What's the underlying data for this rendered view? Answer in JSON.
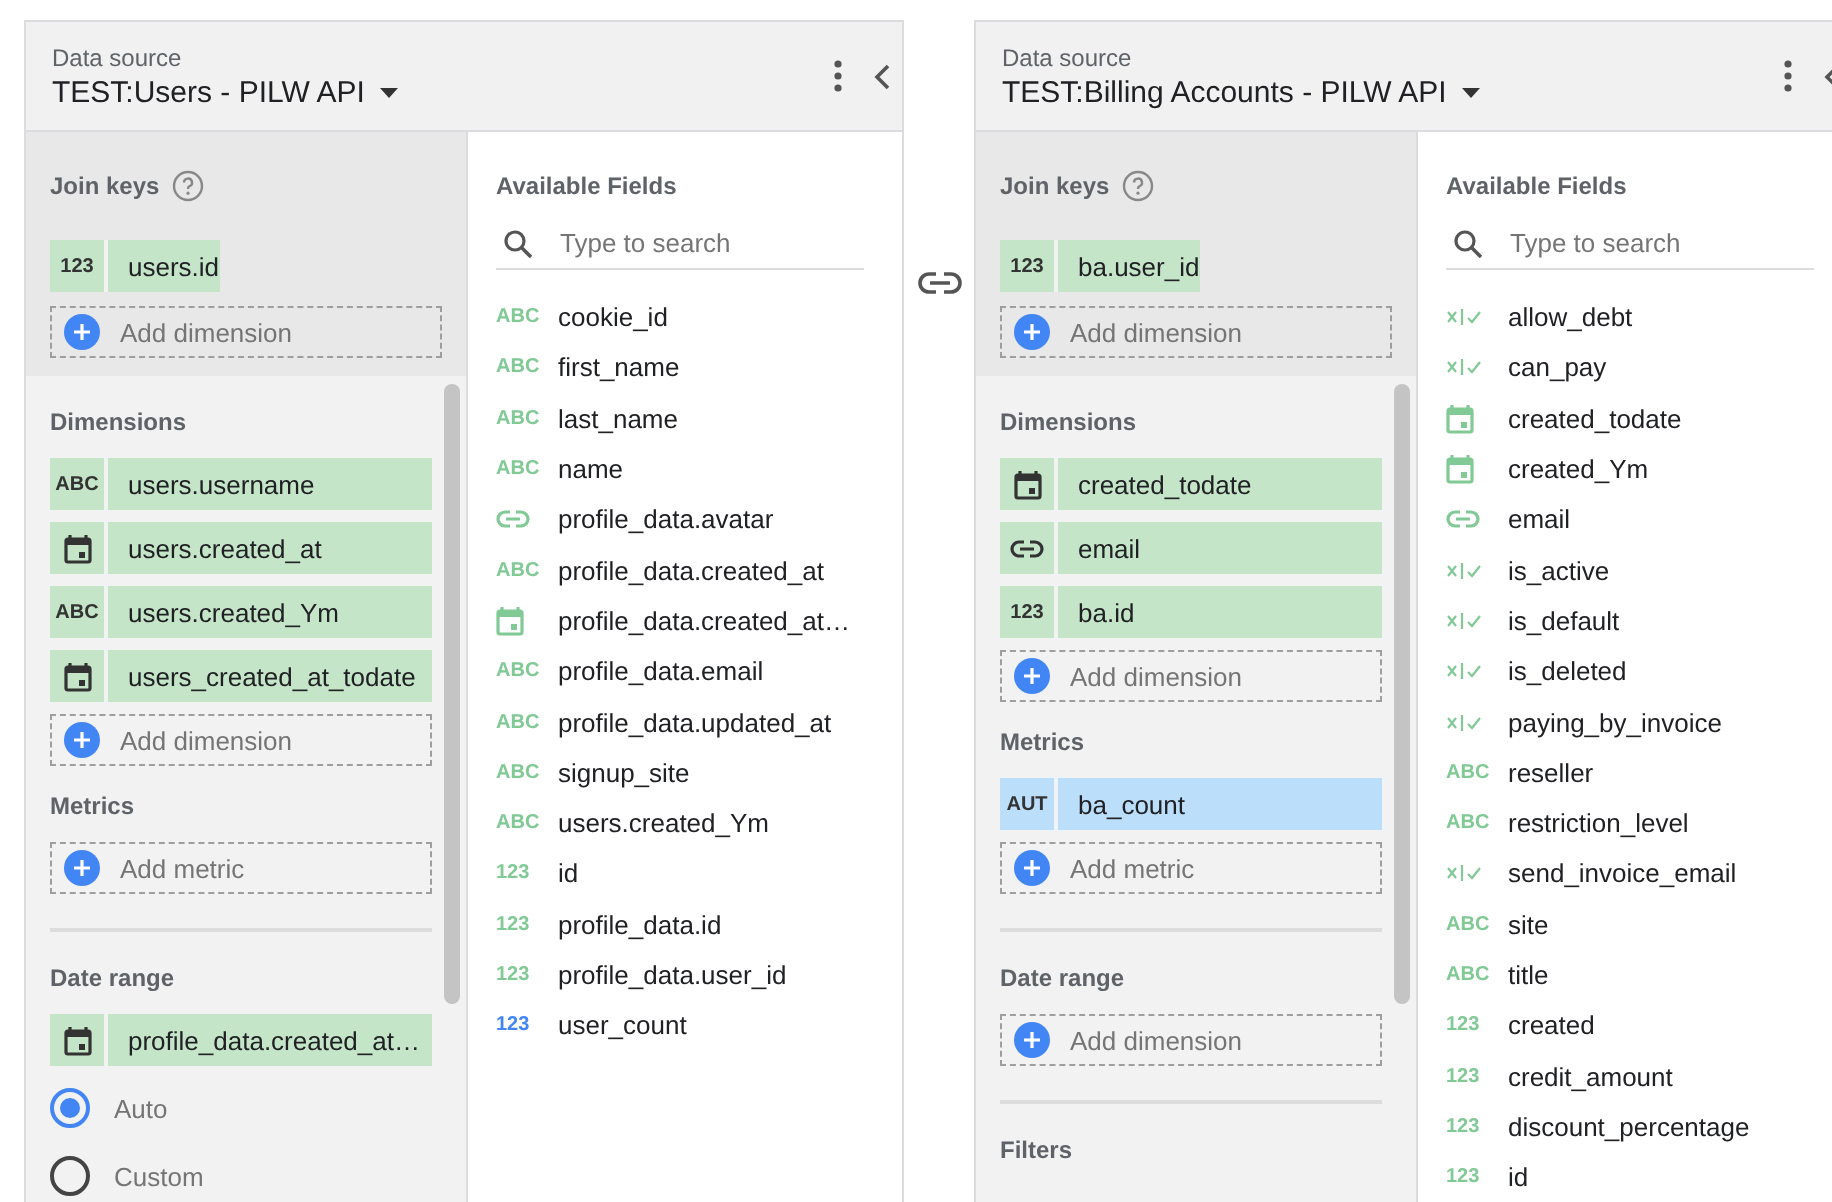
{
  "panels": [
    {
      "label": "Data source",
      "title": "TEST:Users - PILW API",
      "join_keys": {
        "heading": "Join keys",
        "fields": [
          {
            "kind": "number",
            "type_label": "123",
            "name": "users.id"
          }
        ],
        "add_label": "Add dimension"
      },
      "groups": [
        {
          "sections": [
            {
              "heading": "Dimensions",
              "fields": [
                {
                  "kind": "text",
                  "type_label": "ABC",
                  "name": "users.username"
                },
                {
                  "kind": "date",
                  "name": "users.created_at"
                },
                {
                  "kind": "text",
                  "type_label": "ABC",
                  "name": "users.created_Ym"
                },
                {
                  "kind": "date",
                  "name": "users_created_at_todate"
                }
              ],
              "add_label": "Add dimension"
            },
            {
              "heading": "Metrics",
              "add_label": "Add metric"
            }
          ]
        },
        {
          "sections": [
            {
              "heading": "Date range",
              "fields": [
                {
                  "kind": "date",
                  "name": "profile_data.created_at…"
                }
              ],
              "options": [
                {
                  "label": "Auto",
                  "selected": true
                },
                {
                  "label": "Custom",
                  "selected": false
                }
              ]
            }
          ]
        }
      ],
      "available": {
        "heading": "Available Fields",
        "search": {
          "placeholder": "Type to search"
        },
        "fields": [
          {
            "kind": "text",
            "type_label": "ABC",
            "name": "cookie_id"
          },
          {
            "kind": "text",
            "type_label": "ABC",
            "name": "first_name"
          },
          {
            "kind": "text",
            "type_label": "ABC",
            "name": "last_name"
          },
          {
            "kind": "text",
            "type_label": "ABC",
            "name": "name"
          },
          {
            "kind": "link",
            "name": "profile_data.avatar"
          },
          {
            "kind": "text",
            "type_label": "ABC",
            "name": "profile_data.created_at"
          },
          {
            "kind": "date",
            "name": "profile_data.created_at…"
          },
          {
            "kind": "text",
            "type_label": "ABC",
            "name": "profile_data.email"
          },
          {
            "kind": "text",
            "type_label": "ABC",
            "name": "profile_data.updated_at"
          },
          {
            "kind": "text",
            "type_label": "ABC",
            "name": "signup_site"
          },
          {
            "kind": "text",
            "type_label": "ABC",
            "name": "users.created_Ym"
          },
          {
            "kind": "number",
            "type_label": "123",
            "name": "id"
          },
          {
            "kind": "number",
            "type_label": "123",
            "name": "profile_data.id"
          },
          {
            "kind": "number",
            "type_label": "123",
            "name": "profile_data.user_id"
          },
          {
            "kind": "measure",
            "type_label": "123",
            "name": "user_count"
          }
        ]
      }
    },
    {
      "label": "Data source",
      "title": "TEST:Billing Accounts - PILW API",
      "join_keys": {
        "heading": "Join keys",
        "fields": [
          {
            "kind": "number",
            "type_label": "123",
            "name": "ba.user_id"
          }
        ],
        "add_label": "Add dimension"
      },
      "groups": [
        {
          "sections": [
            {
              "heading": "Dimensions",
              "fields": [
                {
                  "kind": "date",
                  "name": "created_todate"
                },
                {
                  "kind": "link",
                  "name": "email"
                },
                {
                  "kind": "number",
                  "type_label": "123",
                  "name": "ba.id"
                }
              ],
              "add_label": "Add dimension"
            },
            {
              "heading": "Metrics",
              "fields": [
                {
                  "kind": "auto",
                  "type_label": "AUT",
                  "name": "ba_count"
                }
              ],
              "add_label": "Add metric"
            }
          ]
        },
        {
          "sections": [
            {
              "heading": "Date range",
              "add_label": "Add dimension"
            }
          ]
        },
        {
          "sections": [
            {
              "heading": "Filters"
            }
          ]
        }
      ],
      "available": {
        "heading": "Available Fields",
        "search": {
          "placeholder": "Type to search"
        },
        "fields": [
          {
            "kind": "boolean",
            "name": "allow_debt"
          },
          {
            "kind": "boolean",
            "name": "can_pay"
          },
          {
            "kind": "date",
            "name": "created_todate"
          },
          {
            "kind": "date",
            "name": "created_Ym"
          },
          {
            "kind": "link",
            "name": "email"
          },
          {
            "kind": "boolean",
            "name": "is_active"
          },
          {
            "kind": "boolean",
            "name": "is_default"
          },
          {
            "kind": "boolean",
            "name": "is_deleted"
          },
          {
            "kind": "boolean",
            "name": "paying_by_invoice"
          },
          {
            "kind": "text",
            "type_label": "ABC",
            "name": "reseller"
          },
          {
            "kind": "text",
            "type_label": "ABC",
            "name": "restriction_level"
          },
          {
            "kind": "boolean",
            "name": "send_invoice_email"
          },
          {
            "kind": "text",
            "type_label": "ABC",
            "name": "site"
          },
          {
            "kind": "text",
            "type_label": "ABC",
            "name": "title"
          },
          {
            "kind": "number",
            "type_label": "123",
            "name": "created"
          },
          {
            "kind": "number",
            "type_label": "123",
            "name": "credit_amount"
          },
          {
            "kind": "number",
            "type_label": "123",
            "name": "discount_percentage"
          },
          {
            "kind": "number",
            "type_label": "123",
            "name": "id"
          }
        ]
      }
    }
  ]
}
